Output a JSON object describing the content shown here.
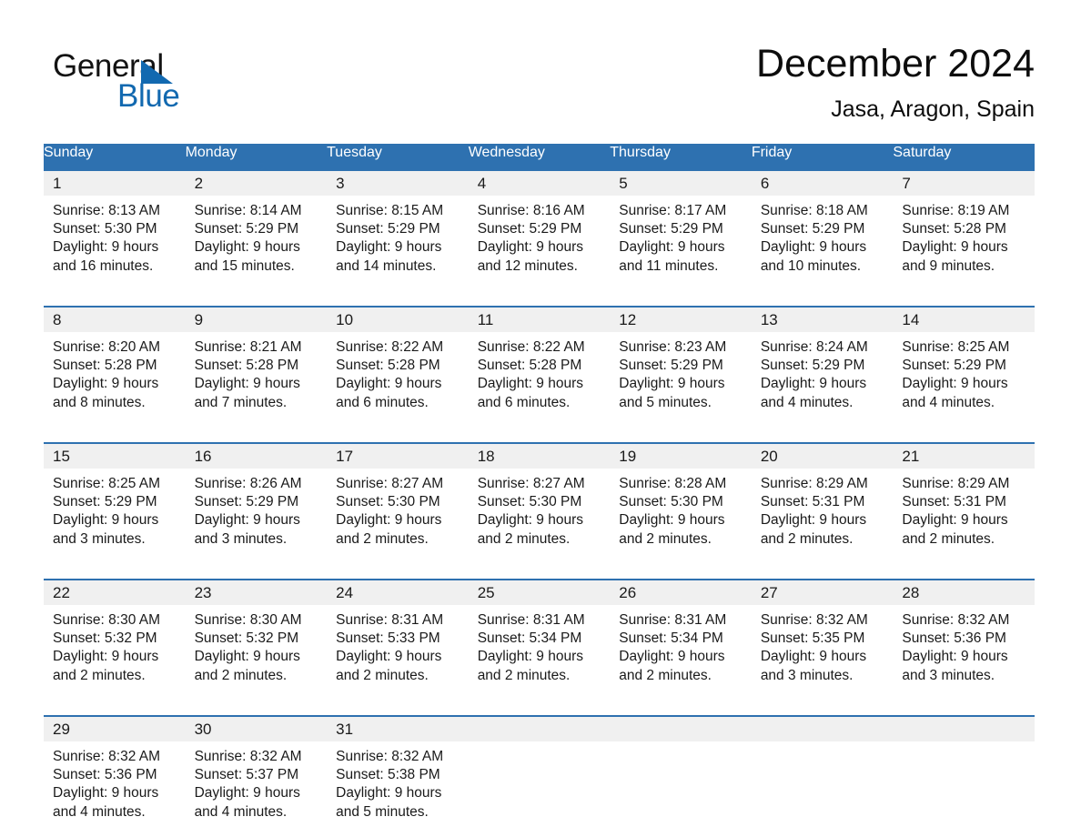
{
  "brand": {
    "line1": "General",
    "line2": "Blue",
    "triangle_color": "#1269b0",
    "text_color": "#131313"
  },
  "header": {
    "title": "December 2024",
    "location": "Jasa, Aragon, Spain"
  },
  "theme": {
    "header_blue": "#2e71b0",
    "daynum_gray": "#f0f0f0",
    "separator_blue": "#2e71b0",
    "text": "#1a1a1a"
  },
  "weekday_headers": [
    "Sunday",
    "Monday",
    "Tuesday",
    "Wednesday",
    "Thursday",
    "Friday",
    "Saturday"
  ],
  "weeks": [
    {
      "days": [
        {
          "date": "1",
          "sunrise": "Sunrise: 8:13 AM",
          "sunset": "Sunset: 5:30 PM",
          "daylight": "Daylight: 9 hours\nand 16 minutes."
        },
        {
          "date": "2",
          "sunrise": "Sunrise: 8:14 AM",
          "sunset": "Sunset: 5:29 PM",
          "daylight": "Daylight: 9 hours\nand 15 minutes."
        },
        {
          "date": "3",
          "sunrise": "Sunrise: 8:15 AM",
          "sunset": "Sunset: 5:29 PM",
          "daylight": "Daylight: 9 hours\nand 14 minutes."
        },
        {
          "date": "4",
          "sunrise": "Sunrise: 8:16 AM",
          "sunset": "Sunset: 5:29 PM",
          "daylight": "Daylight: 9 hours\nand 12 minutes."
        },
        {
          "date": "5",
          "sunrise": "Sunrise: 8:17 AM",
          "sunset": "Sunset: 5:29 PM",
          "daylight": "Daylight: 9 hours\nand 11 minutes."
        },
        {
          "date": "6",
          "sunrise": "Sunrise: 8:18 AM",
          "sunset": "Sunset: 5:29 PM",
          "daylight": "Daylight: 9 hours\nand 10 minutes."
        },
        {
          "date": "7",
          "sunrise": "Sunrise: 8:19 AM",
          "sunset": "Sunset: 5:28 PM",
          "daylight": "Daylight: 9 hours\nand 9 minutes."
        }
      ]
    },
    {
      "days": [
        {
          "date": "8",
          "sunrise": "Sunrise: 8:20 AM",
          "sunset": "Sunset: 5:28 PM",
          "daylight": "Daylight: 9 hours\nand 8 minutes."
        },
        {
          "date": "9",
          "sunrise": "Sunrise: 8:21 AM",
          "sunset": "Sunset: 5:28 PM",
          "daylight": "Daylight: 9 hours\nand 7 minutes."
        },
        {
          "date": "10",
          "sunrise": "Sunrise: 8:22 AM",
          "sunset": "Sunset: 5:28 PM",
          "daylight": "Daylight: 9 hours\nand 6 minutes."
        },
        {
          "date": "11",
          "sunrise": "Sunrise: 8:22 AM",
          "sunset": "Sunset: 5:28 PM",
          "daylight": "Daylight: 9 hours\nand 6 minutes."
        },
        {
          "date": "12",
          "sunrise": "Sunrise: 8:23 AM",
          "sunset": "Sunset: 5:29 PM",
          "daylight": "Daylight: 9 hours\nand 5 minutes."
        },
        {
          "date": "13",
          "sunrise": "Sunrise: 8:24 AM",
          "sunset": "Sunset: 5:29 PM",
          "daylight": "Daylight: 9 hours\nand 4 minutes."
        },
        {
          "date": "14",
          "sunrise": "Sunrise: 8:25 AM",
          "sunset": "Sunset: 5:29 PM",
          "daylight": "Daylight: 9 hours\nand 4 minutes."
        }
      ]
    },
    {
      "days": [
        {
          "date": "15",
          "sunrise": "Sunrise: 8:25 AM",
          "sunset": "Sunset: 5:29 PM",
          "daylight": "Daylight: 9 hours\nand 3 minutes."
        },
        {
          "date": "16",
          "sunrise": "Sunrise: 8:26 AM",
          "sunset": "Sunset: 5:29 PM",
          "daylight": "Daylight: 9 hours\nand 3 minutes."
        },
        {
          "date": "17",
          "sunrise": "Sunrise: 8:27 AM",
          "sunset": "Sunset: 5:30 PM",
          "daylight": "Daylight: 9 hours\nand 2 minutes."
        },
        {
          "date": "18",
          "sunrise": "Sunrise: 8:27 AM",
          "sunset": "Sunset: 5:30 PM",
          "daylight": "Daylight: 9 hours\nand 2 minutes."
        },
        {
          "date": "19",
          "sunrise": "Sunrise: 8:28 AM",
          "sunset": "Sunset: 5:30 PM",
          "daylight": "Daylight: 9 hours\nand 2 minutes."
        },
        {
          "date": "20",
          "sunrise": "Sunrise: 8:29 AM",
          "sunset": "Sunset: 5:31 PM",
          "daylight": "Daylight: 9 hours\nand 2 minutes."
        },
        {
          "date": "21",
          "sunrise": "Sunrise: 8:29 AM",
          "sunset": "Sunset: 5:31 PM",
          "daylight": "Daylight: 9 hours\nand 2 minutes."
        }
      ]
    },
    {
      "days": [
        {
          "date": "22",
          "sunrise": "Sunrise: 8:30 AM",
          "sunset": "Sunset: 5:32 PM",
          "daylight": "Daylight: 9 hours\nand 2 minutes."
        },
        {
          "date": "23",
          "sunrise": "Sunrise: 8:30 AM",
          "sunset": "Sunset: 5:32 PM",
          "daylight": "Daylight: 9 hours\nand 2 minutes."
        },
        {
          "date": "24",
          "sunrise": "Sunrise: 8:31 AM",
          "sunset": "Sunset: 5:33 PM",
          "daylight": "Daylight: 9 hours\nand 2 minutes."
        },
        {
          "date": "25",
          "sunrise": "Sunrise: 8:31 AM",
          "sunset": "Sunset: 5:34 PM",
          "daylight": "Daylight: 9 hours\nand 2 minutes."
        },
        {
          "date": "26",
          "sunrise": "Sunrise: 8:31 AM",
          "sunset": "Sunset: 5:34 PM",
          "daylight": "Daylight: 9 hours\nand 2 minutes."
        },
        {
          "date": "27",
          "sunrise": "Sunrise: 8:32 AM",
          "sunset": "Sunset: 5:35 PM",
          "daylight": "Daylight: 9 hours\nand 3 minutes."
        },
        {
          "date": "28",
          "sunrise": "Sunrise: 8:32 AM",
          "sunset": "Sunset: 5:36 PM",
          "daylight": "Daylight: 9 hours\nand 3 minutes."
        }
      ]
    },
    {
      "days": [
        {
          "date": "29",
          "sunrise": "Sunrise: 8:32 AM",
          "sunset": "Sunset: 5:36 PM",
          "daylight": "Daylight: 9 hours\nand 4 minutes."
        },
        {
          "date": "30",
          "sunrise": "Sunrise: 8:32 AM",
          "sunset": "Sunset: 5:37 PM",
          "daylight": "Daylight: 9 hours\nand 4 minutes."
        },
        {
          "date": "31",
          "sunrise": "Sunrise: 8:32 AM",
          "sunset": "Sunset: 5:38 PM",
          "daylight": "Daylight: 9 hours\nand 5 minutes."
        },
        {
          "date": "",
          "sunrise": "",
          "sunset": "",
          "daylight": ""
        },
        {
          "date": "",
          "sunrise": "",
          "sunset": "",
          "daylight": ""
        },
        {
          "date": "",
          "sunrise": "",
          "sunset": "",
          "daylight": ""
        },
        {
          "date": "",
          "sunrise": "",
          "sunset": "",
          "daylight": ""
        }
      ]
    }
  ]
}
